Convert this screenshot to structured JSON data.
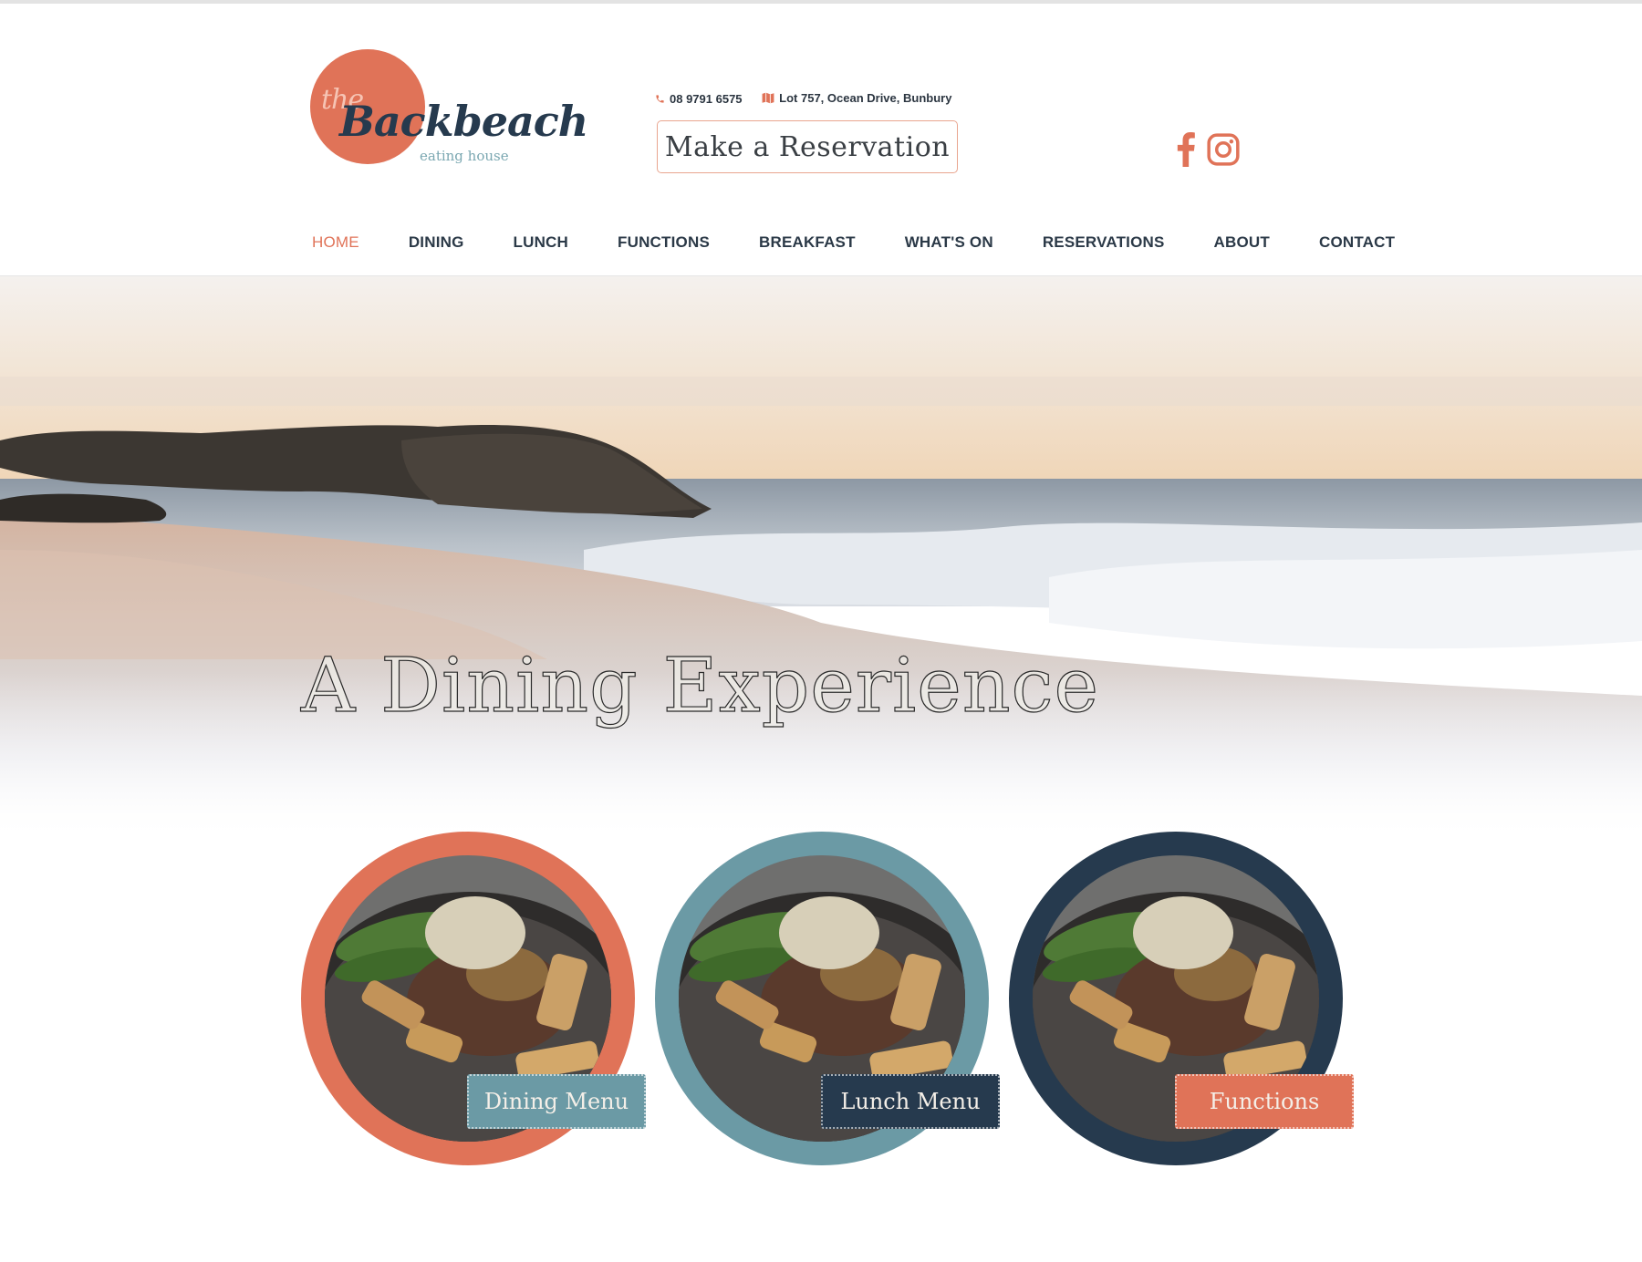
{
  "brand": {
    "logo_the": "the",
    "logo_name": "Backbeach",
    "logo_sub": "eating house"
  },
  "contact": {
    "phone": "08 9791 6575",
    "address": "Lot 757, Ocean Drive, Bunbury"
  },
  "header": {
    "reserve_label": "Make a Reservation"
  },
  "social": {
    "facebook": "facebook-icon",
    "instagram": "instagram-icon"
  },
  "nav": {
    "items": [
      "HOME",
      "DINING",
      "LUNCH",
      "FUNCTIONS",
      "BREAKFAST",
      "WHAT'S ON",
      "RESERVATIONS",
      "ABOUT",
      "CONTACT"
    ],
    "active": "HOME"
  },
  "hero": {
    "title": "A Dining Experience"
  },
  "cards": [
    {
      "label": "Dining Menu",
      "ring_color": "#e07358",
      "button_color": "#6b9aa5"
    },
    {
      "label": "Lunch Menu",
      "ring_color": "#6b9aa5",
      "button_color": "#263a4e"
    },
    {
      "label": "Functions",
      "ring_color": "#263a4e",
      "button_color": "#e07358"
    }
  ],
  "colors": {
    "accent": "#e07358",
    "teal": "#6b9aa5",
    "navy": "#263a4e"
  }
}
